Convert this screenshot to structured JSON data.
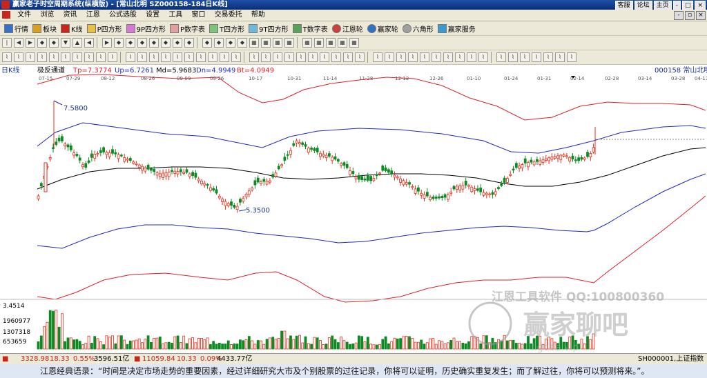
{
  "window": {
    "title": "赢家老子时空周期系统(纵横版) - [常山北明   SZ000158-184日K线]",
    "buttons": [
      "客服",
      "论坛",
      "主页",
      "-",
      "□",
      "×"
    ]
  },
  "menu": [
    "文件",
    "浏览",
    "资讯",
    "江恩",
    "公式选股",
    "设置",
    "工具",
    "窗口",
    "交易委托",
    "帮助"
  ],
  "toolbar1": [
    "行情",
    "板块",
    "K线",
    "P四方形",
    "9P四方形",
    "P数字表",
    "T四方形",
    "9T四方形",
    "T数字表",
    "江恩轮",
    "赢家轮",
    "六角形",
    "赢家服务"
  ],
  "chart_header": {
    "period": "日K线",
    "indicator": "极反通道",
    "tp": "Tp=7.3774",
    "up": "Up=6.7261",
    "md": "Md=5.9683",
    "dn": "Dn=4.9949",
    "bt": "Bt=4.0949",
    "code_name": "000158  常山北明"
  },
  "x_labels": [
    "07-15",
    "07-29",
    "08-12",
    "08-26",
    "09-09",
    "09-26",
    "10-17",
    "10-31",
    "11-14",
    "11-28",
    "12-12",
    "12-26",
    "01-10",
    "01-24",
    "01-31",
    "02-14",
    "02-28",
    "03-14",
    "03-28",
    "04-11"
  ],
  "price_labels": {
    "high": "7.5800",
    "low": "5.3500"
  },
  "volume_labels": [
    "3.4514",
    "1960977",
    "1307318",
    "653659"
  ],
  "watermark": {
    "line1": "江恩工具软件  QQ:100800360",
    "line2": "赢家聊吧",
    "line3": "ligoba.vip"
  },
  "statusbar": {
    "sh": "3328.98",
    "sh_chg": "18.33",
    "sh_pct": "0.55%",
    "sh_amt": "3596.51亿",
    "sz": "11059.84",
    "sz_chg": "10.33",
    "sz_pct": "0.09%",
    "sz_amt": "4433.77亿",
    "right_code": "SH000001,上证指数"
  },
  "quote": "江恩经典语录：“时间是决定市场走势的重要因素，经过详细研究大市及个别股票的过往记录，你将可以证明，历史确实重复发生；而了解过往，你将可以预测将来。”。",
  "colors": {
    "up": "#e8301c",
    "down": "#0e8a24",
    "band_outer": "#e0202a",
    "band_inner": "#2028c8",
    "mid": "#000000"
  }
}
